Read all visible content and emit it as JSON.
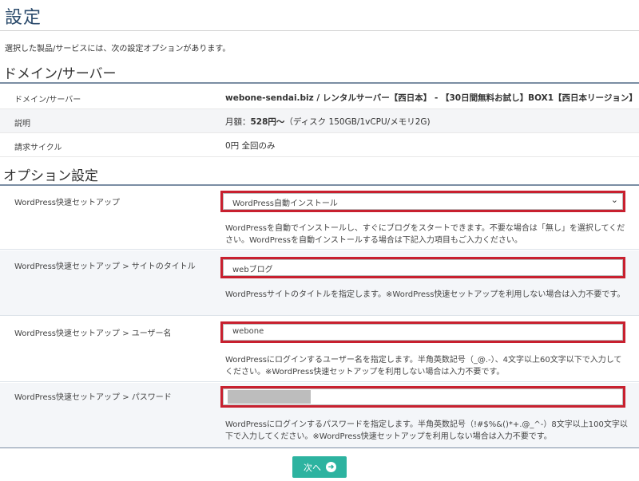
{
  "page": {
    "title": "設定",
    "intro": "選択した製品/サービスには、次の設定オプションがあります。"
  },
  "domain_section": {
    "heading": "ドメイン/サーバー",
    "rows": [
      {
        "label": "ドメイン/サーバー",
        "value": "webone-sendai.biz / レンタルサーバー【西日本】 - 【30日間無料お試し】BOX1【西日本リージョン】"
      },
      {
        "label": "説明",
        "value_prefix": "月額：",
        "value_bold": "528円〜",
        "value_suffix": "（ディスク 150GB/1vCPU/メモリ2G)"
      },
      {
        "label": "請求サイクル",
        "value": "0円 全回のみ"
      }
    ]
  },
  "options_section": {
    "heading": "オプション設定",
    "fields": [
      {
        "label": "WordPress快速セットアップ",
        "value": "WordPress自動インストール",
        "help": "WordPressを自動でインストールし、すぐにブログをスタートできます。不要な場合は「無し」を選択してください。WordPressを自動インストールする場合は下記入力項目もご入力ください。"
      },
      {
        "label": "WordPress快速セットアップ > サイトのタイトル",
        "value": "webブログ",
        "help": "WordPressサイトのタイトルを指定します。※WordPress快速セットアップを利用しない場合は入力不要です。"
      },
      {
        "label": "WordPress快速セットアップ > ユーザー名",
        "value": "webone",
        "help": "WordPressにログインするユーザー名を指定します。半角英数記号（_@.-）、4文字以上60文字以下で入力してください。※WordPress快速セットアップを利用しない場合は入力不要です。"
      },
      {
        "label": "WordPress快速セットアップ > パスワード",
        "value": "",
        "help": "WordPressにログインするパスワードを指定します。半角英数記号（!#$%&()*+.@_^-）8文字以上100文字以下で入力してください。※WordPress快速セットアップを利用しない場合は入力不要です。"
      }
    ]
  },
  "actions": {
    "next_label": "次へ",
    "next_icon": "arrow-right-circle-icon"
  },
  "colors": {
    "highlight_border": "#c8202f",
    "button": "#2db3a0",
    "title": "#2a4a6b"
  }
}
